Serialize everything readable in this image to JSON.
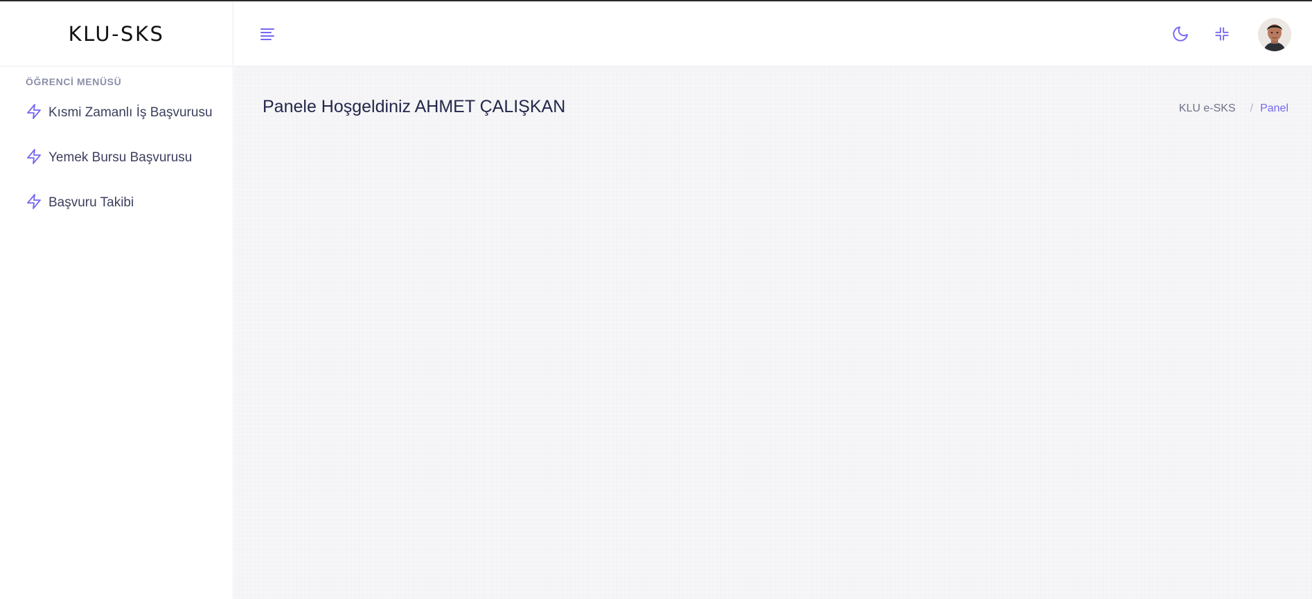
{
  "brand": {
    "name": "KLU-SKS"
  },
  "sidebar": {
    "section_title": "ÖĞRENCİ MENÜSÜ",
    "items": [
      {
        "label": "Kısmi Zamanlı İş Başvurusu",
        "icon": "zap-icon"
      },
      {
        "label": "Yemek Bursu Başvurusu",
        "icon": "zap-icon"
      },
      {
        "label": "Başvuru Takibi",
        "icon": "zap-icon"
      }
    ]
  },
  "header": {
    "menu_toggle_icon": "hamburger-menu-icon",
    "theme_toggle_icon": "moon-icon",
    "fullscreen_icon": "minimize-icon",
    "avatar": "user-avatar"
  },
  "main": {
    "title": "Panele Hoşgeldiniz AHMET ÇALIŞKAN",
    "breadcrumb": {
      "root": "KLU e-SKS",
      "separator": "/",
      "current": "Panel"
    }
  },
  "colors": {
    "accent": "#7367f0",
    "text_dark": "#23274a",
    "muted": "#8a8fa8",
    "background": "#f6f6f8"
  }
}
